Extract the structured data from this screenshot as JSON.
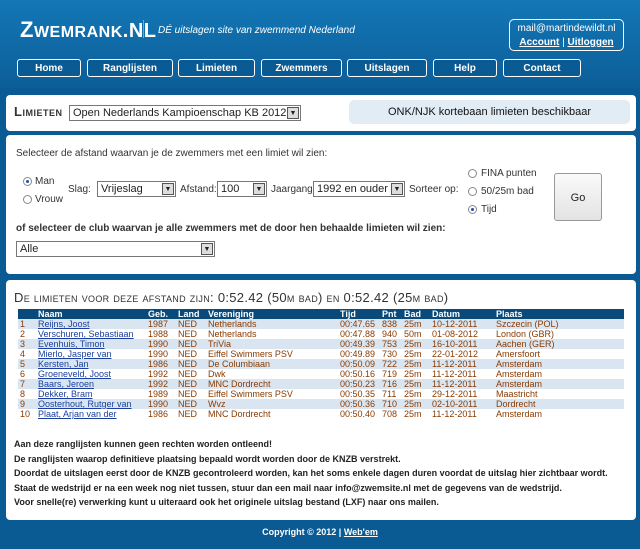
{
  "header": {
    "logo_main": "WEMRANK",
    "logo_first": "Z",
    "logo_suffix": ".NL",
    "tagline": "DÉ uitslagen site van zwemmend Nederland",
    "user_email": "mail@martindewildt.nl",
    "account_link": "Account",
    "separator": "|",
    "logout_link": "Uitloggen"
  },
  "nav": [
    {
      "label": "Home"
    },
    {
      "label": "Ranglijsten"
    },
    {
      "label": "Limieten"
    },
    {
      "label": "Zwemmers"
    },
    {
      "label": "Uitslagen"
    },
    {
      "label": "Help"
    },
    {
      "label": "Contact"
    }
  ],
  "limieten": {
    "title": "Limieten",
    "competition_select": "Open Nederlands Kampioenschap KB 2012",
    "info": "ONK/NJK kortebaan limieten beschikbaar"
  },
  "filter": {
    "intro": "Selecteer de afstand waarvan je de zwemmers met een limiet wil zien:",
    "gender_man": "Man",
    "gender_vrouw": "Vrouw",
    "slag_label": "Slag:",
    "slag_value": "Vrijeslag",
    "afstand_label": "Afstand:",
    "afstand_value": "100",
    "jaargang_label": "Jaargang:",
    "jaargang_value": "1992 en ouder",
    "sorteer_label": "Sorteer op:",
    "sort_fina": "FINA punten",
    "sort_bad": "50/25m bad",
    "sort_tijd": "Tijd",
    "go_label": "Go",
    "club_intro": "of selecteer de club waarvan je alle zwemmers met de door hen behaalde limieten wil zien:",
    "club_value": "Alle"
  },
  "results": {
    "title": "De limieten voor deze afstand zijn: 0:52.42 (50m bad) en 0:52.42 (25m bad)",
    "headers": [
      "",
      "Naam",
      "Geb.",
      "Land",
      "Vereniging",
      "Tijd",
      "Pnt",
      "Bad",
      "Datum",
      "Plaats"
    ],
    "rows": [
      [
        "1",
        "Reijns, Joost",
        "1987",
        "NED",
        "Netherlands",
        "00:47.65",
        "838",
        "25m",
        "10-12-2011",
        "Szczecin (POL)"
      ],
      [
        "2",
        "Verschuren, Sebastiaan",
        "1988",
        "NED",
        "Netherlands",
        "00:47.88",
        "940",
        "50m",
        "01-08-2012",
        "London (GBR)"
      ],
      [
        "3",
        "Evenhuis, Timon",
        "1990",
        "NED",
        "TriVia",
        "00:49.39",
        "753",
        "25m",
        "16-10-2011",
        "Aachen (GER)"
      ],
      [
        "4",
        "Mierlo, Jasper van",
        "1990",
        "NED",
        "Eiffel Swimmers PSV",
        "00:49.89",
        "730",
        "25m",
        "22-01-2012",
        "Amersfoort"
      ],
      [
        "5",
        "Kersten, Jan",
        "1986",
        "NED",
        "De Columbiaan",
        "00:50.09",
        "722",
        "25m",
        "11-12-2011",
        "Amsterdam"
      ],
      [
        "6",
        "Groeneveld, Joost",
        "1992",
        "NED",
        "Dwk",
        "00:50.16",
        "719",
        "25m",
        "11-12-2011",
        "Amsterdam"
      ],
      [
        "7",
        "Baars, Jeroen",
        "1992",
        "NED",
        "MNC Dordrecht",
        "00:50.23",
        "716",
        "25m",
        "11-12-2011",
        "Amsterdam"
      ],
      [
        "8",
        "Dekker, Bram",
        "1989",
        "NED",
        "Eiffel Swimmers PSV",
        "00:50.35",
        "711",
        "25m",
        "29-12-2011",
        "Maastricht"
      ],
      [
        "9",
        "Oosterhout, Rutger van",
        "1990",
        "NED",
        "Wvz",
        "00:50.36",
        "710",
        "25m",
        "02-10-2011",
        "Dordrecht"
      ],
      [
        "10",
        "Plaat, Arjan van der",
        "1986",
        "NED",
        "MNC Dordrecht",
        "00:50.40",
        "708",
        "25m",
        "11-12-2011",
        "Amsterdam"
      ]
    ]
  },
  "notes": [
    "Aan deze ranglijsten kunnen geen rechten worden ontleend!",
    "De ranglijsten waarop definitieve plaatsing bepaald wordt worden door de KNZB verstrekt.",
    "Doordat de uitslagen eerst door de KNZB gecontroleerd worden, kan het soms enkele dagen duren voordat de uitslag hier zichtbaar wordt.",
    "Staat de wedstrijd er na een week nog niet tussen, stuur dan een mail naar info@zwemsite.nl met de gegevens van de wedstrijd.",
    "Voor snelle(re) verwerking kunt u uiteraard ook het originele uitslag bestand (LXF) naar ons mailen."
  ],
  "footer": {
    "copyright": "Copyright © 2012 |",
    "link": "Web'em"
  }
}
